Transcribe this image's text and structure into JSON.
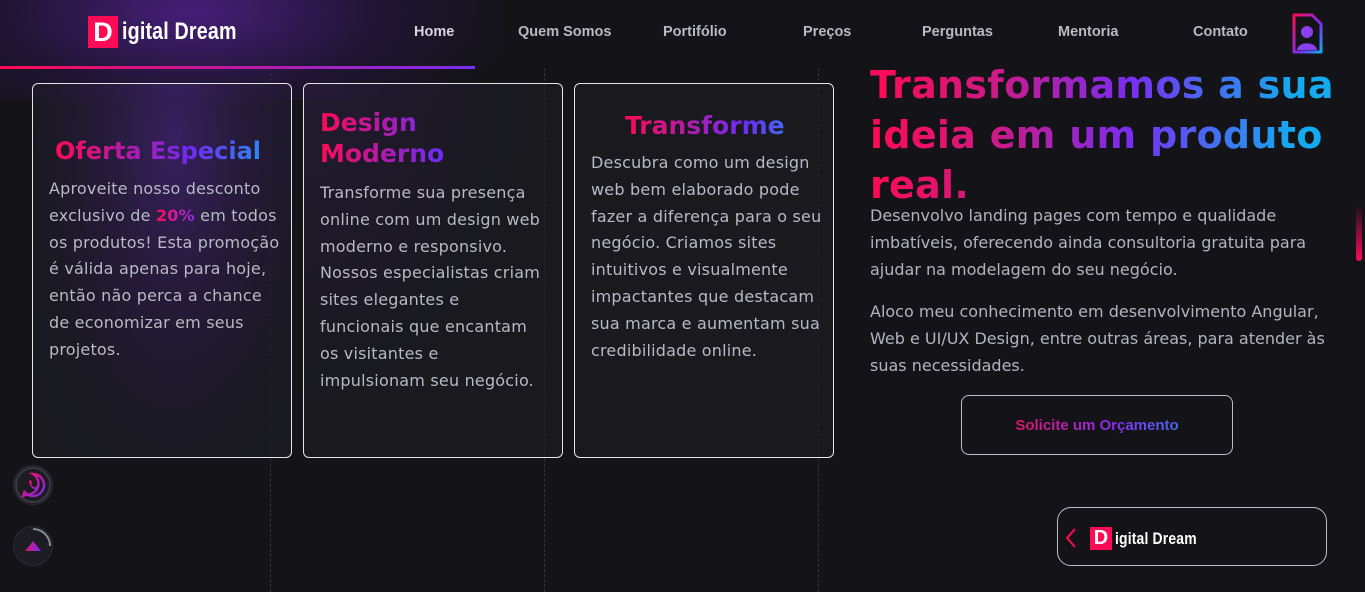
{
  "brand": {
    "logo_letter": "D",
    "logo_text": "igital Dream"
  },
  "nav": {
    "items": [
      "Home",
      "Quem Somos",
      "Portifólio",
      "Preços",
      "Perguntas",
      "Mentoria",
      "Contato"
    ]
  },
  "cards": [
    {
      "title": "Oferta Especial",
      "body_before": "Aproveite nosso desconto exclusivo de ",
      "highlight": "20%",
      "body_after": " em todos os produtos! Esta promoção é válida apenas para hoje, então não perca a chance de economizar em seus projetos."
    },
    {
      "title": "Design Moderno",
      "body": "Transforme sua presença online com um design web moderno e responsivo. Nossos especialistas criam sites elegantes e funcionais que encantam os visitantes e impulsionam seu negócio."
    },
    {
      "title": "Transforme",
      "body": "Descubra como um design web bem elaborado pode fazer a diferença para o seu negócio. Criamos sites intuitivos e visualmente impactantes que destacam sua marca e aumentam sua credibilidade online."
    }
  ],
  "hero": {
    "title": "Transformamos a sua ideia em um produto real.",
    "paragraph_1": "Desenvolvo landing pages com tempo e qualidade imbatíveis, oferecendo ainda consultoria gratuita para ajudar na modelagem do seu negócio.",
    "paragraph_2": "Aloco meu conhecimento em desenvolvimento Angular, Web e UI/UX Design, entre outras áreas, para atender às suas necessidades.",
    "cta_label": "Solicite um Orçamento"
  },
  "footer_badge": {
    "logo_letter": "D",
    "logo_text": "igital Dream"
  },
  "icons": {
    "doc": "document-user-icon",
    "whatsapp": "whatsapp-icon",
    "scroll_top": "arrow-up-icon",
    "back": "chevron-left-icon"
  },
  "colors": {
    "accent_pink": "#ff0a54",
    "accent_purple": "#7a2cf0",
    "accent_blue": "#14aaf0",
    "background": "#141418"
  }
}
